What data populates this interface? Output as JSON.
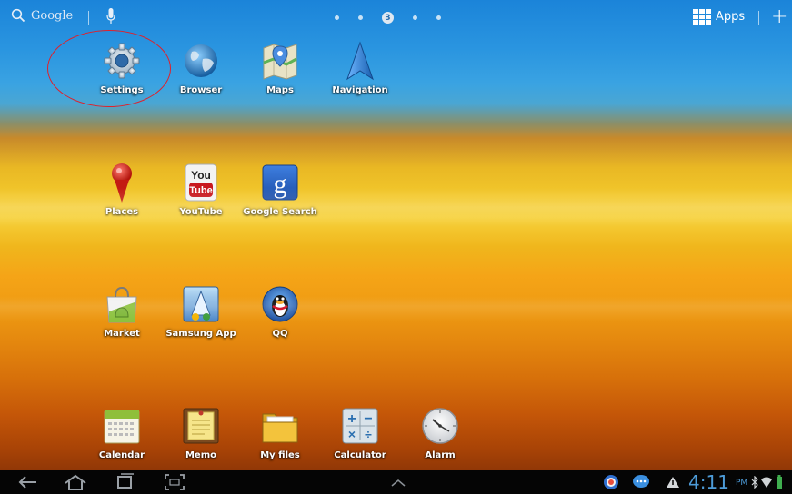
{
  "topbar": {
    "search_label": "Google",
    "current_page": "3",
    "apps_label": "Apps"
  },
  "apps": {
    "row1": [
      "Settings",
      "Browser",
      "Maps",
      "Navigation"
    ],
    "row2": [
      "Places",
      "YouTube",
      "Google Search"
    ],
    "row3": [
      "Market",
      "Samsung App",
      "QQ"
    ],
    "row4": [
      "Calendar",
      "Memo",
      "My files",
      "Calculator",
      "Alarm"
    ]
  },
  "status": {
    "time": "4:11",
    "ampm": "PM"
  },
  "colors": {
    "clock": "#4d9bd8",
    "highlight_circle": "#e0202a"
  },
  "icons": [
    "search-icon",
    "mic-icon",
    "apps-grid-icon",
    "plus-icon",
    "back-icon",
    "home-icon",
    "recent-apps-icon",
    "screenshot-icon",
    "up-arrow-icon",
    "notification-icon",
    "chat-icon",
    "warning-icon",
    "bluetooth-icon",
    "wifi-icon",
    "battery-icon"
  ]
}
